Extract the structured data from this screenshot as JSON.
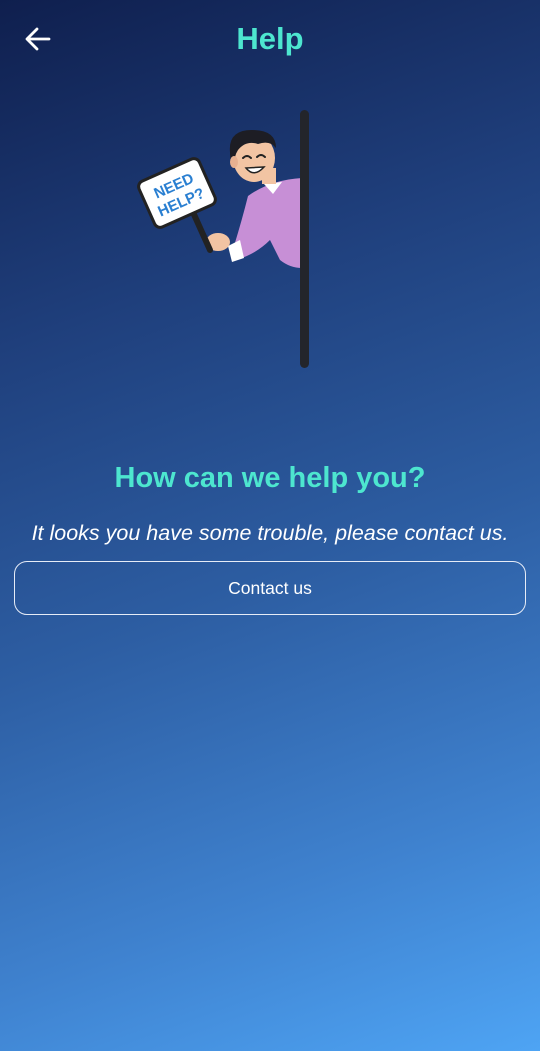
{
  "header": {
    "title": "Help",
    "back_icon": "arrow-left-icon"
  },
  "illustration": {
    "sign_line1": "NEED",
    "sign_line2": "HELP?"
  },
  "main": {
    "heading": "How can we help you?",
    "subtitle": "It looks you have some trouble, please contact us.",
    "contact_button_label": "Contact us"
  },
  "colors": {
    "accent": "#4de6cf",
    "text": "#ffffff",
    "gradient_top": "#0f1f4e",
    "gradient_bottom": "#4ea4f4"
  }
}
